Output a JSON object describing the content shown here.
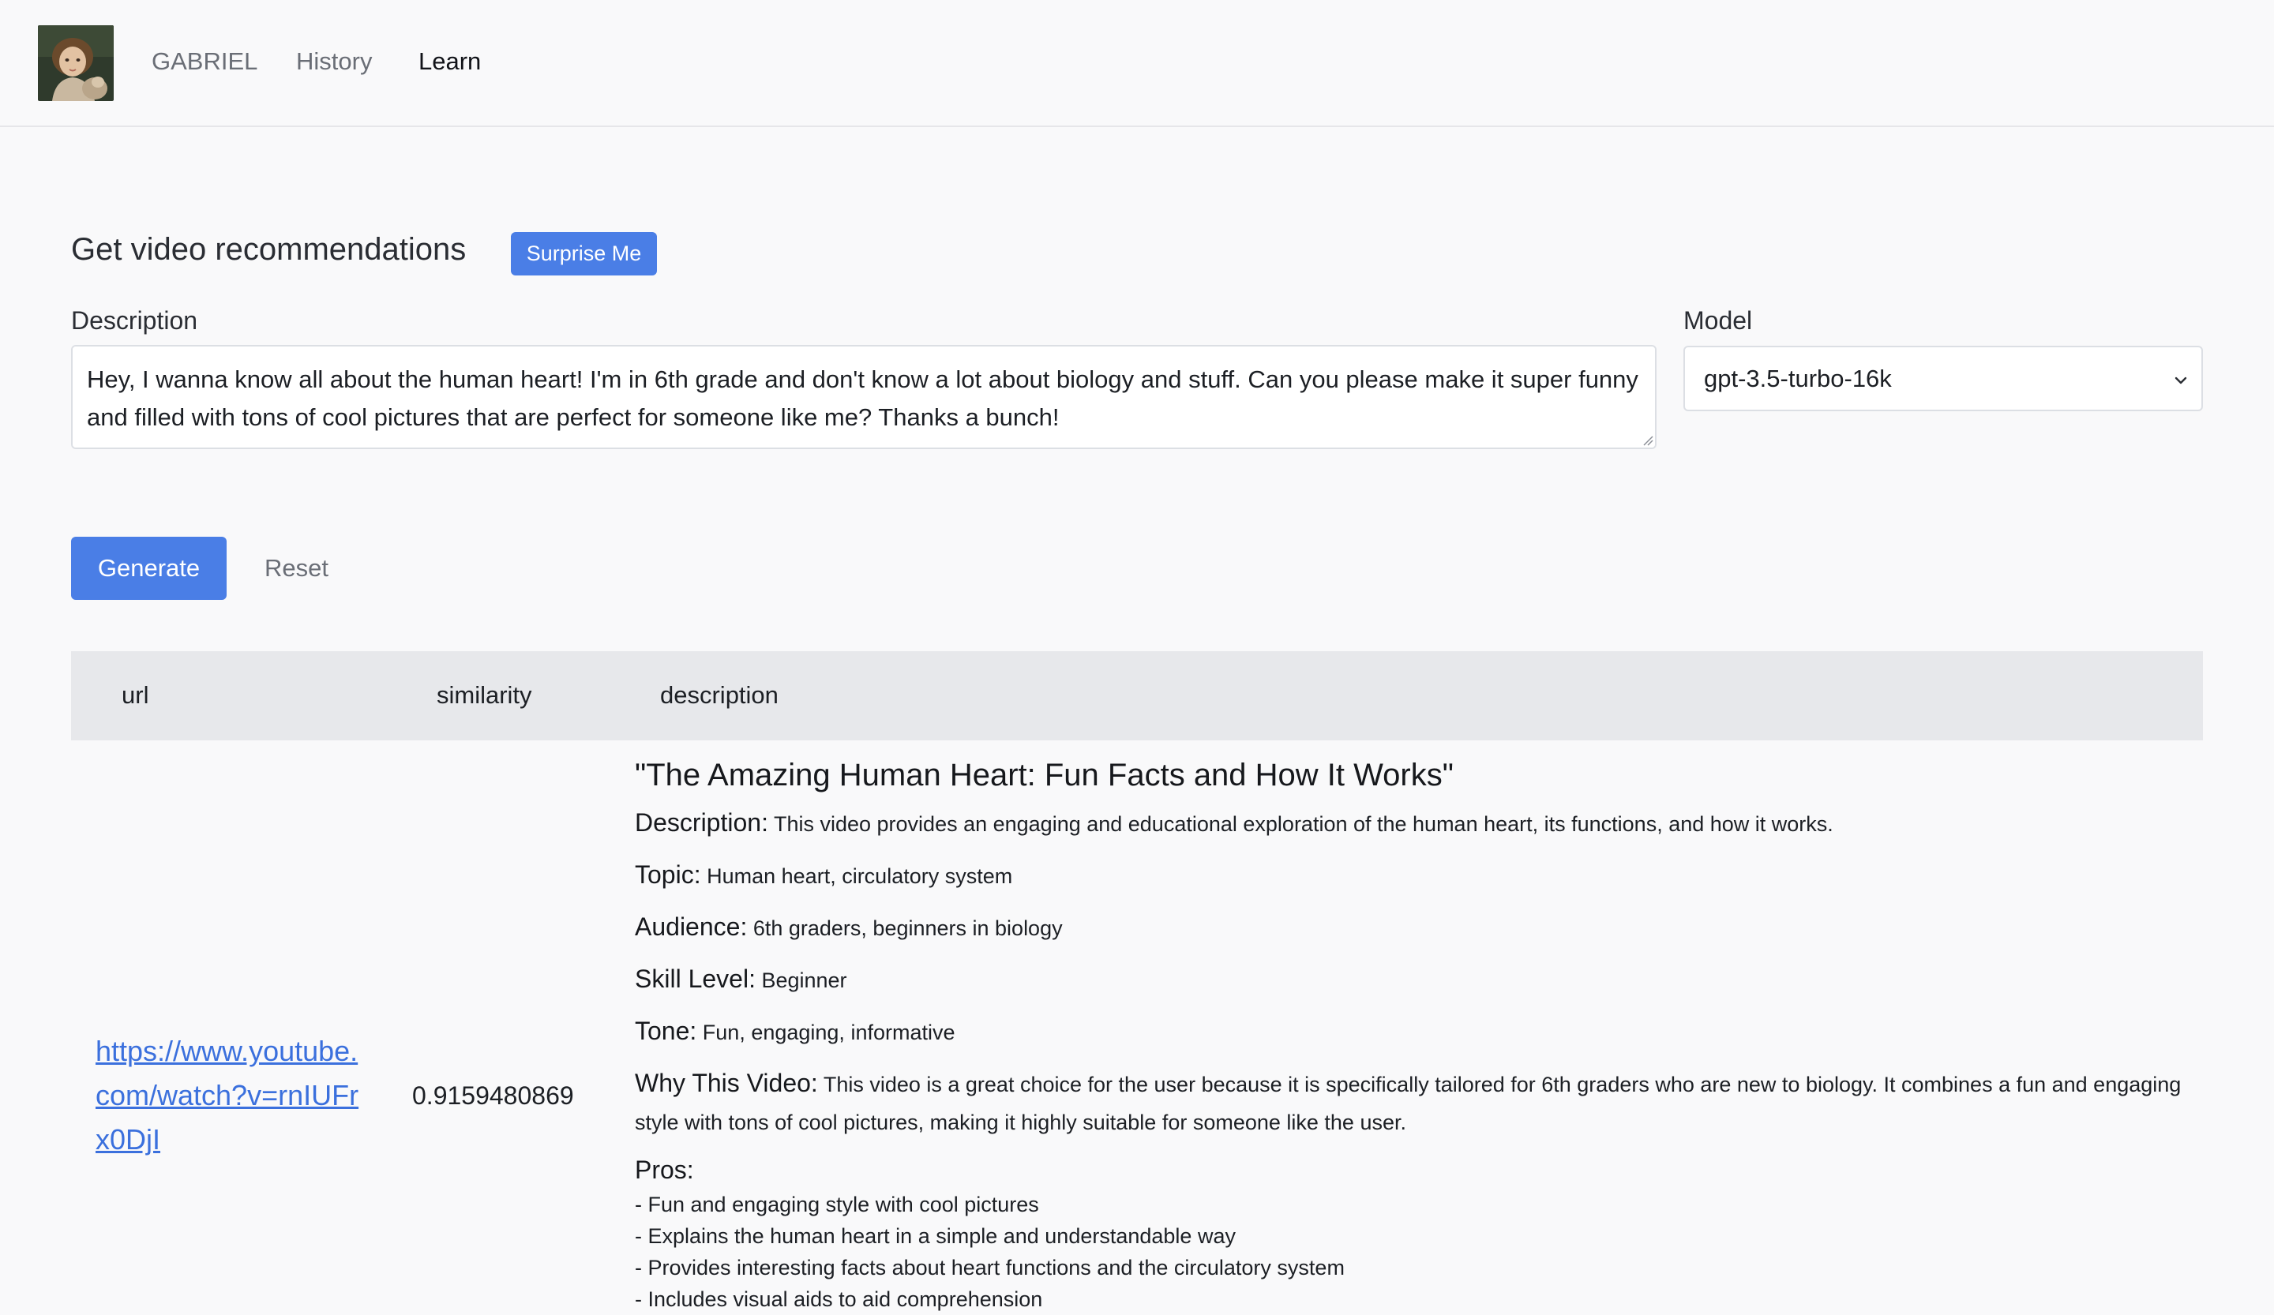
{
  "nav": {
    "brand": "GABRIEL",
    "history": "History",
    "learn": "Learn"
  },
  "form": {
    "section_title": "Get video recommendations",
    "surprise_label": "Surprise Me",
    "description_label": "Description",
    "description_value": "Hey, I wanna know all about the human heart! I'm in 6th grade and don't know a lot about biology and stuff. Can you please make it super funny and filled with tons of cool pictures that are perfect for someone like me? Thanks a bunch!",
    "model_label": "Model",
    "model_value": "gpt-3.5-turbo-16k",
    "generate_label": "Generate",
    "reset_label": "Reset"
  },
  "table": {
    "headers": [
      "url",
      "similarity",
      "description"
    ],
    "rows": [
      {
        "url": "https://www.youtube.com/watch?v=rnIUFrx0DjI",
        "similarity": "0.9159480869",
        "title": "\"The Amazing Human Heart: Fun Facts and How It Works\"",
        "fields": [
          {
            "key": "Description:",
            "value": "This video provides an engaging and educational exploration of the human heart, its functions, and how it works."
          },
          {
            "key": "Topic:",
            "value": "Human heart, circulatory system"
          },
          {
            "key": "Audience:",
            "value": "6th graders, beginners in biology"
          },
          {
            "key": "Skill Level:",
            "value": "Beginner"
          },
          {
            "key": "Tone:",
            "value": "Fun, engaging, informative"
          },
          {
            "key": "Why This Video:",
            "value": "This video is a great choice for the user because it is specifically tailored for 6th graders who are new to biology. It combines a fun and engaging style with tons of cool pictures, making it highly suitable for someone like the user."
          }
        ],
        "pros_label": "Pros:",
        "pros": [
          "- Fun and engaging style with cool pictures",
          "- Explains the human heart in a simple and understandable way",
          "- Provides interesting facts about heart functions and the circulatory system",
          "- Includes visual aids to aid comprehension"
        ]
      }
    ]
  },
  "colors": {
    "accent": "#4a7ee6",
    "link": "#3b70dd",
    "table_header_bg": "#e7e8eb",
    "page_bg": "#f9f9fa"
  }
}
